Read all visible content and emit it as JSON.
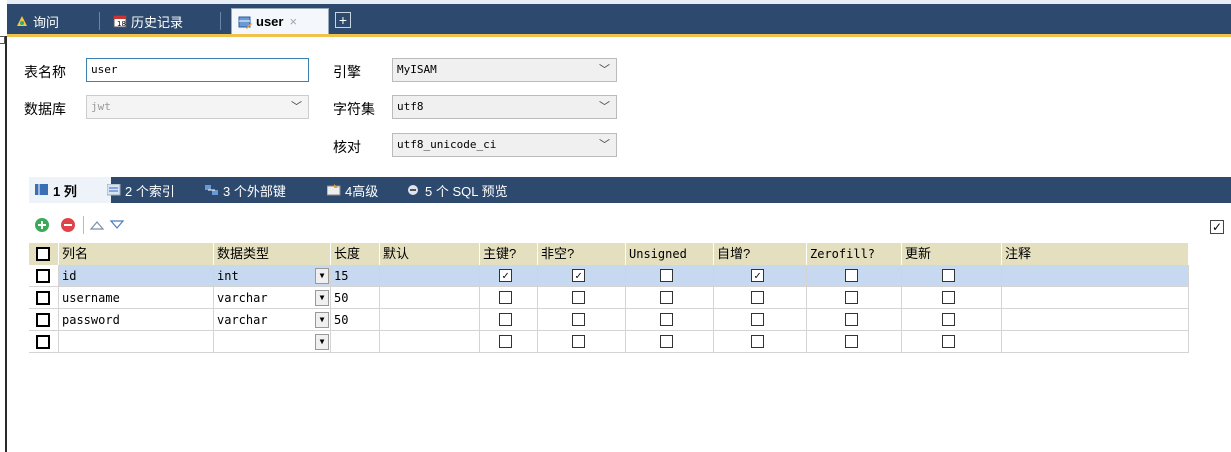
{
  "tabs": [
    {
      "label": "询问",
      "icon": "query-icon"
    },
    {
      "label": "历史记录",
      "icon": "history-icon"
    },
    {
      "label": "user",
      "icon": "table-edit-icon",
      "close": "×"
    }
  ],
  "new_tab_label": "+",
  "form": {
    "table_name_label": "表名称",
    "table_name_value": "user",
    "database_label": "数据库",
    "database_value": "jwt",
    "engine_label": "引擎",
    "engine_value": "MyISAM",
    "charset_label": "字符集",
    "charset_value": "utf8",
    "collation_label": "核对",
    "collation_value": "utf8_unicode_ci"
  },
  "subtabs": [
    {
      "label": "1 列",
      "icon": "columns-icon"
    },
    {
      "label": "2 个索引",
      "icon": "index-icon"
    },
    {
      "label": "3 个外部键",
      "icon": "foreign-key-icon"
    },
    {
      "label": "4高级",
      "icon": "advanced-icon"
    },
    {
      "label": "5 个 SQL 预览",
      "icon": "sql-preview-icon"
    }
  ],
  "columns_headers": [
    "列名",
    "数据类型",
    "长度",
    "默认",
    "主键?",
    "非空?",
    "Unsigned",
    "自增?",
    "Zerofill?",
    "更新",
    "注释"
  ],
  "rows": [
    {
      "name": "id",
      "type": "int",
      "length": "15",
      "default": "",
      "pk": true,
      "notnull": true,
      "unsigned": false,
      "autoinc": true,
      "zerofill": false,
      "update": false,
      "comment": ""
    },
    {
      "name": "username",
      "type": "varchar",
      "length": "50",
      "default": "",
      "pk": false,
      "notnull": false,
      "unsigned": false,
      "autoinc": false,
      "zerofill": false,
      "update": false,
      "comment": ""
    },
    {
      "name": "password",
      "type": "varchar",
      "length": "50",
      "default": "",
      "pk": false,
      "notnull": false,
      "unsigned": false,
      "autoinc": false,
      "zerofill": false,
      "update": false,
      "comment": ""
    },
    {
      "name": "",
      "type": "",
      "length": "",
      "default": "",
      "pk": false,
      "notnull": false,
      "unsigned": false,
      "autoinc": false,
      "zerofill": false,
      "update": false,
      "comment": ""
    }
  ],
  "hide_language_options_checked": true,
  "colors": {
    "titlebar": "#2d4a6e",
    "accent": "#f0c14b",
    "header": "#e4dfbf",
    "selected_row": "#c7d9f0"
  }
}
